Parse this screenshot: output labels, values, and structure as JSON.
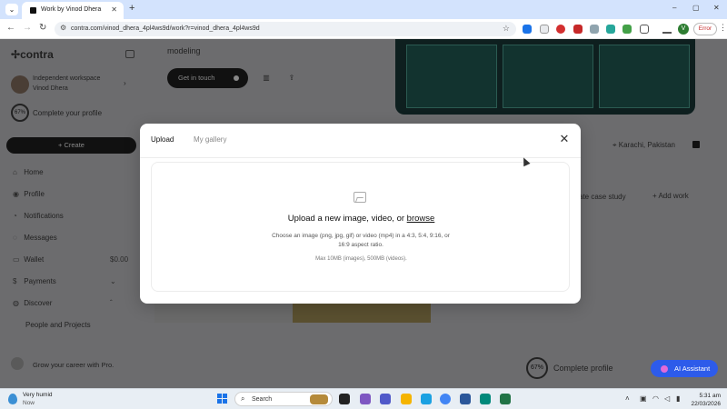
{
  "browser": {
    "tab_title": "Work by Vinod Dhera",
    "tab_menu_icon": "chevron-down",
    "new_tab_symbol": "+",
    "url": "contra.com/vinod_dhera_4pl4ws9d/work?r=vinod_dhera_4pl4ws9d",
    "profile_initial": "V",
    "error_label": "Error",
    "minimize": "–",
    "maximize": "▢",
    "close": "✕"
  },
  "sidebar": {
    "logo": "contra",
    "workspace_title": "Independent workspace",
    "workspace_user": "Vinod Dhera",
    "profile_progress": "67%",
    "complete_profile": "Complete your profile",
    "create_label": "+ Create",
    "items": [
      {
        "label": "Home",
        "icon": "home-icon"
      },
      {
        "label": "Profile",
        "icon": "user-icon"
      },
      {
        "label": "Notifications",
        "icon": "bell-icon"
      },
      {
        "label": "Messages",
        "icon": "message-icon"
      },
      {
        "label": "Wallet",
        "icon": "wallet-icon",
        "value": "$0.00"
      },
      {
        "label": "Payments",
        "icon": "payments-icon"
      },
      {
        "label": "Discover",
        "icon": "compass-icon"
      }
    ],
    "sub_item": "People and Projects",
    "career_text": "Grow your career with Pro."
  },
  "main": {
    "heading_fragment": "modeling",
    "get_in_touch": "Get in touch",
    "location": "Karachi, Pakistan",
    "case_study": "ate case study",
    "add_work": "+ Add work",
    "profile_progress": "67%",
    "complete_profile": "Complete profile",
    "ai_assistant": "AI Assistant"
  },
  "modal": {
    "tab_upload": "Upload",
    "tab_gallery": "My gallery",
    "title_prefix": "Upload a new image, video, or ",
    "browse": "browse",
    "subtitle": "Choose an image (png, jpg, gif) or video (mp4) in a 4:3, 5:4, 9:16, or 16:9 aspect ratio.",
    "max_note": "Max 10MB (images), 500MB (videos)."
  },
  "taskbar": {
    "weather_title": "Very humid",
    "weather_sub": "Now",
    "search_label": "Search",
    "time": "5:31 am",
    "date": "22/03/2026"
  },
  "colors": {
    "accent": "#2d5bea",
    "tabstrip": "#d3e3fd",
    "overlay": "#6c6c6e"
  }
}
